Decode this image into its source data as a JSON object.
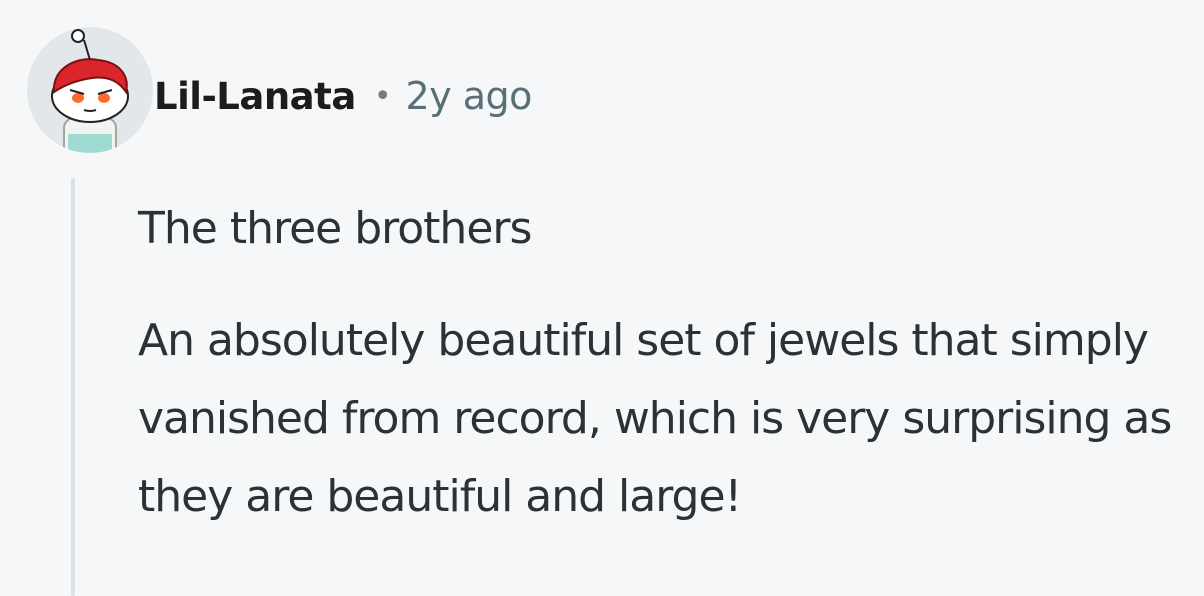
{
  "comment": {
    "author": "Lil-Lanata",
    "separator": "•",
    "time": "2y ago",
    "avatar_icon": "reddit-snoo-avatar-icon",
    "paragraphs": [
      "The three brothers",
      "An absolutely beautiful set of jewels that simply vanished from record, which is very surprising as they are beautiful and large!"
    ]
  },
  "colors": {
    "background": "#f6f7f8",
    "username": "#1c1c1c",
    "timestamp": "#576f76",
    "body_text": "#2a3236",
    "thread_line": "#d8e2ea",
    "avatar_hair": "#d9252b"
  }
}
